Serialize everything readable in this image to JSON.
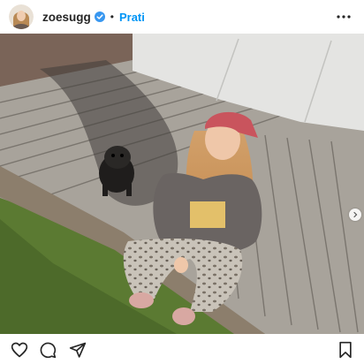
{
  "post": {
    "username": "zoesugg",
    "separator": "•",
    "follow_label": "Prati"
  },
  "icons": {
    "avatar": "avatar-image",
    "verified": "verified-badge-icon",
    "more": "more-options-icon",
    "next": "chevron-right-icon",
    "like": "heart-icon",
    "comment": "comment-icon",
    "share": "share-icon",
    "save": "bookmark-icon"
  },
  "colors": {
    "accent": "#0095f6",
    "text": "#262626",
    "verified": "#3897f0"
  }
}
